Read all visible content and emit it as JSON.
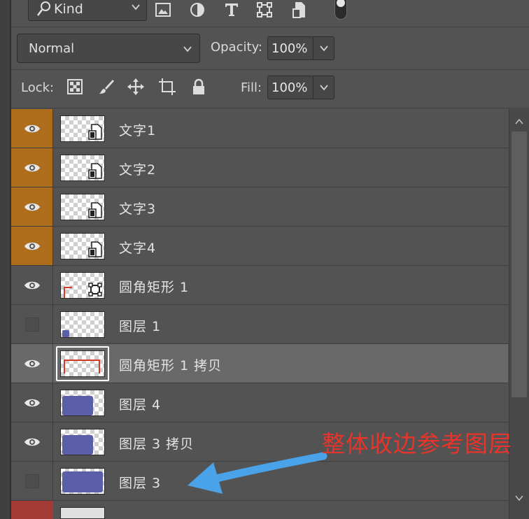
{
  "filter": {
    "kind_label": "Kind",
    "icons": [
      "image-filter-icon",
      "adjustment-filter-icon",
      "type-filter-icon",
      "shape-filter-icon",
      "smart-object-filter-icon"
    ]
  },
  "blend": {
    "mode": "Normal",
    "opacity_label": "Opacity:",
    "opacity_value": "100%"
  },
  "lock": {
    "label": "Lock:",
    "fill_label": "Fill:",
    "fill_value": "100%",
    "icons": [
      "lock-transparent-pixels-icon",
      "lock-image-pixels-icon",
      "lock-position-icon",
      "prevent-autonest-icon",
      "lock-all-icon"
    ]
  },
  "layers": [
    {
      "name": "文字1",
      "visible": true,
      "highlight": "orange",
      "thumb": "smart"
    },
    {
      "name": "文字2",
      "visible": true,
      "highlight": "orange",
      "thumb": "smart"
    },
    {
      "name": "文字3",
      "visible": true,
      "highlight": "orange",
      "thumb": "smart"
    },
    {
      "name": "文字4",
      "visible": true,
      "highlight": "orange",
      "thumb": "smart"
    },
    {
      "name": "圆角矩形 1",
      "visible": true,
      "highlight": "none",
      "thumb": "shape"
    },
    {
      "name": "图层 1",
      "visible": false,
      "highlight": "none",
      "thumb": "pixel-small"
    },
    {
      "name": "圆角矩形 1 拷贝",
      "visible": true,
      "highlight": "none",
      "thumb": "shape-frame",
      "selected": true
    },
    {
      "name": "图层 4",
      "visible": true,
      "highlight": "none",
      "thumb": "pixel-blue"
    },
    {
      "name": "图层 3 拷贝",
      "visible": true,
      "highlight": "none",
      "thumb": "pixel-blue"
    },
    {
      "name": "图层 3",
      "visible": false,
      "highlight": "none",
      "thumb": "pixel-blue-full"
    }
  ],
  "annotation": "整体收边参考图层",
  "colors": {
    "panel": "#535353",
    "highlight_orange": "#ad6d1b",
    "selected_row": "#696969",
    "annotation": "#e8342a",
    "arrow": "#4aa3e8",
    "bottom_red": "#a33a35"
  }
}
